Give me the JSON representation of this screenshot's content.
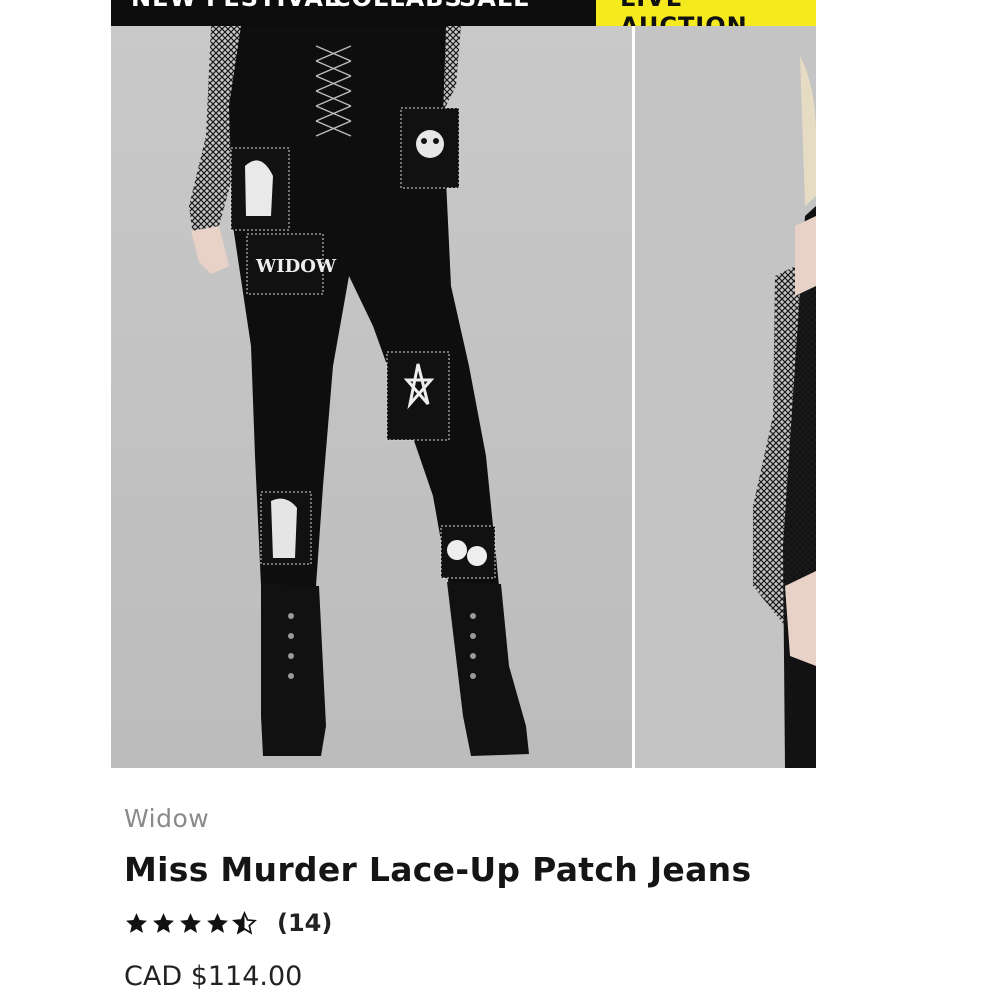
{
  "nav": {
    "items": [
      "NEW",
      "FESTIVAL",
      "COLLABS",
      "SALE"
    ],
    "auction_label": "LIVE AUCTION",
    "bar_color": "#0c0c0c",
    "auction_color": "#f5ea1d"
  },
  "gallery": {
    "main_image": "model-wearing-black-patch-jeans",
    "next_image": "model-side-view-fishnet-sleeve"
  },
  "product": {
    "brand": "Widow",
    "title": "Miss Murder Lace-Up Patch Jeans",
    "rating": 4.5,
    "rating_max": 5,
    "review_count": "(14)",
    "price": "CAD $114.00"
  }
}
